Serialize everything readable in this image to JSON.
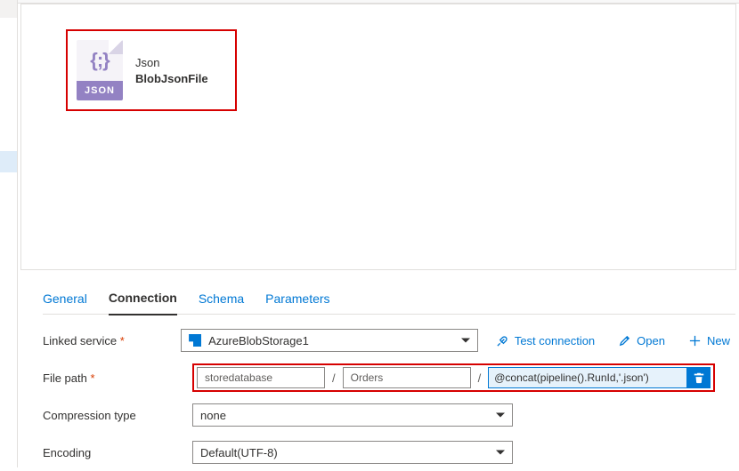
{
  "dataset": {
    "icon_braces": "{;}",
    "icon_band": "JSON",
    "type_label": "Json",
    "name": "BlobJsonFile"
  },
  "tabs": {
    "general": "General",
    "connection": "Connection",
    "schema": "Schema",
    "parameters": "Parameters"
  },
  "form": {
    "linked_service_label": "Linked service",
    "linked_service_value": "AzureBlobStorage1",
    "file_path_label": "File path",
    "container_value": "storedatabase",
    "folder_value": "Orders",
    "file_expression": "@concat(pipeline().RunId,'.json')",
    "separator": "/",
    "compression_label": "Compression type",
    "compression_value": "none",
    "encoding_label": "Encoding",
    "encoding_value": "Default(UTF-8)"
  },
  "actions": {
    "test": "Test connection",
    "open": "Open",
    "new": "New"
  }
}
